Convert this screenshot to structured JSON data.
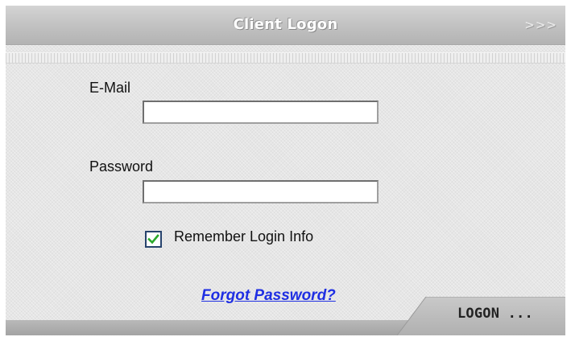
{
  "header": {
    "title": "Client Logon",
    "chevrons": ">>>"
  },
  "form": {
    "email_label": "E-Mail",
    "email_value": "",
    "password_label": "Password",
    "password_value": "",
    "remember_label": "Remember Login Info",
    "remember_checked": true,
    "forgot_link": "Forgot Password?",
    "logon_button": "LOGON ..."
  },
  "colors": {
    "link": "#1f2fe3",
    "check": "#2aa92a",
    "checkbox_border": "#27436d"
  },
  "icons": {
    "checkbox": "checkmark-icon",
    "chevrons": "chevrons-right-icon"
  }
}
